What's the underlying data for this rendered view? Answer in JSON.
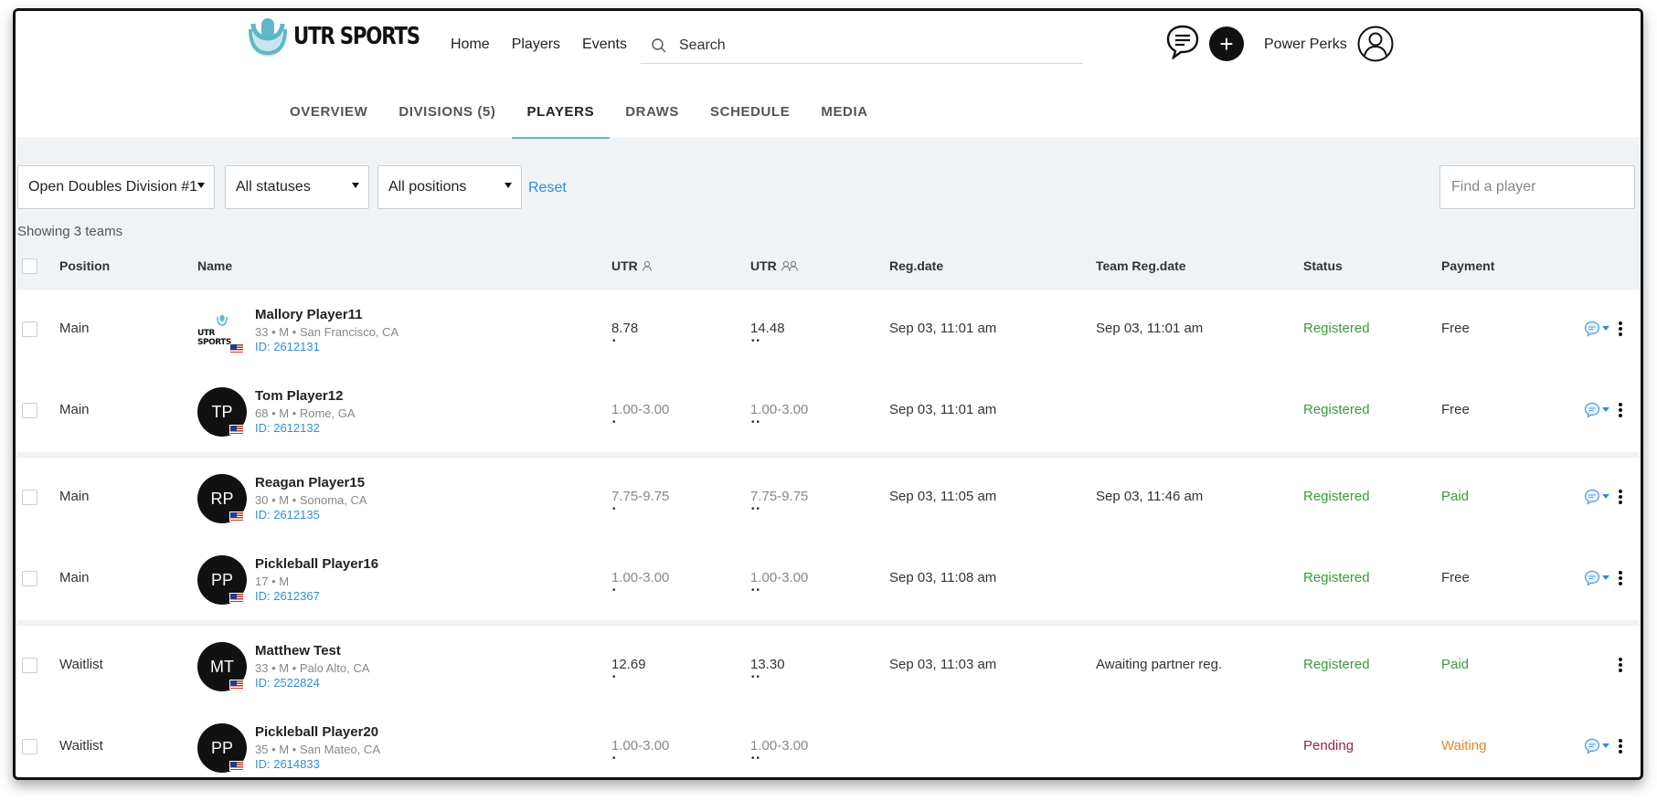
{
  "app": {
    "logo_text": "UTR SPORTS"
  },
  "topnav": {
    "items": [
      "Home",
      "Players",
      "Events"
    ]
  },
  "search": {
    "placeholder": "Search"
  },
  "user": {
    "name": "Power Perks"
  },
  "tabs": [
    {
      "label": "OVERVIEW",
      "active": false
    },
    {
      "label": "DIVISIONS (5)",
      "active": false
    },
    {
      "label": "PLAYERS",
      "active": true
    },
    {
      "label": "DRAWS",
      "active": false
    },
    {
      "label": "SCHEDULE",
      "active": false
    },
    {
      "label": "MEDIA",
      "active": false
    }
  ],
  "filters": {
    "division": "Open Doubles Division #1",
    "status": "All statuses",
    "position": "All positions",
    "reset_label": "Reset",
    "find_placeholder": "Find a player",
    "showing": "Showing 3 teams"
  },
  "columns": {
    "position": "Position",
    "name": "Name",
    "utr_singles": "UTR",
    "utr_doubles": "UTR",
    "reg_date": "Reg.date",
    "team_reg_date": "Team Reg.date",
    "status": "Status",
    "payment": "Payment"
  },
  "colors": {
    "accent": "#58b9c9",
    "link": "#2f8fd5",
    "registered": "#3b9a3b",
    "pending": "#8e2a48",
    "waiting": "#e3862d",
    "band": "#eff3f6"
  },
  "groups": [
    {
      "rows": [
        {
          "position": "Main",
          "avatar_type": "logo",
          "initials": "",
          "name": "Mallory Player11",
          "meta": "33 • M • San Francisco, CA",
          "id": "ID: 2612131",
          "utr_s": "8.78",
          "utr_s_range": false,
          "utr_d": "14.48",
          "utr_d_range": false,
          "reg_date": "Sep 03, 11:01 am",
          "team_reg_date": "Sep 03, 11:01 am",
          "status": "Registered",
          "payment": "Free",
          "has_msg": true
        },
        {
          "position": "Main",
          "avatar_type": "initials",
          "initials": "TP",
          "name": "Tom Player12",
          "meta": "68 • M • Rome, GA",
          "id": "ID: 2612132",
          "utr_s": "1.00-3.00",
          "utr_s_range": true,
          "utr_d": "1.00-3.00",
          "utr_d_range": true,
          "reg_date": "Sep 03, 11:01 am",
          "team_reg_date": "",
          "status": "Registered",
          "payment": "Free",
          "has_msg": true
        }
      ]
    },
    {
      "rows": [
        {
          "position": "Main",
          "avatar_type": "initials",
          "initials": "RP",
          "name": "Reagan Player15",
          "meta": "30 • M • Sonoma, CA",
          "id": "ID: 2612135",
          "utr_s": "7.75-9.75",
          "utr_s_range": true,
          "utr_d": "7.75-9.75",
          "utr_d_range": true,
          "reg_date": "Sep 03, 11:05 am",
          "team_reg_date": "Sep 03, 11:46 am",
          "status": "Registered",
          "payment": "Paid",
          "has_msg": true
        },
        {
          "position": "Main",
          "avatar_type": "initials",
          "initials": "PP",
          "name": "Pickleball Player16",
          "meta": "17 • M",
          "id": "ID: 2612367",
          "utr_s": "1.00-3.00",
          "utr_s_range": true,
          "utr_d": "1.00-3.00",
          "utr_d_range": true,
          "reg_date": "Sep 03, 11:08 am",
          "team_reg_date": "",
          "status": "Registered",
          "payment": "Free",
          "has_msg": true
        }
      ]
    },
    {
      "rows": [
        {
          "position": "Waitlist",
          "avatar_type": "initials",
          "initials": "MT",
          "name": "Matthew Test",
          "meta": "33 • M • Palo Alto, CA",
          "id": "ID: 2522824",
          "utr_s": "12.69",
          "utr_s_range": false,
          "utr_d": "13.30",
          "utr_d_range": false,
          "reg_date": "Sep 03, 11:03 am",
          "team_reg_date": "Awaiting partner reg.",
          "status": "Registered",
          "payment": "Paid",
          "has_msg": false
        },
        {
          "position": "Waitlist",
          "avatar_type": "initials",
          "initials": "PP",
          "name": "Pickleball Player20",
          "meta": "35 • M • San Mateo, CA",
          "id": "ID: 2614833",
          "utr_s": "1.00-3.00",
          "utr_s_range": true,
          "utr_d": "1.00-3.00",
          "utr_d_range": true,
          "reg_date": "",
          "team_reg_date": "",
          "status": "Pending",
          "payment": "Waiting",
          "has_msg": true
        }
      ]
    }
  ]
}
